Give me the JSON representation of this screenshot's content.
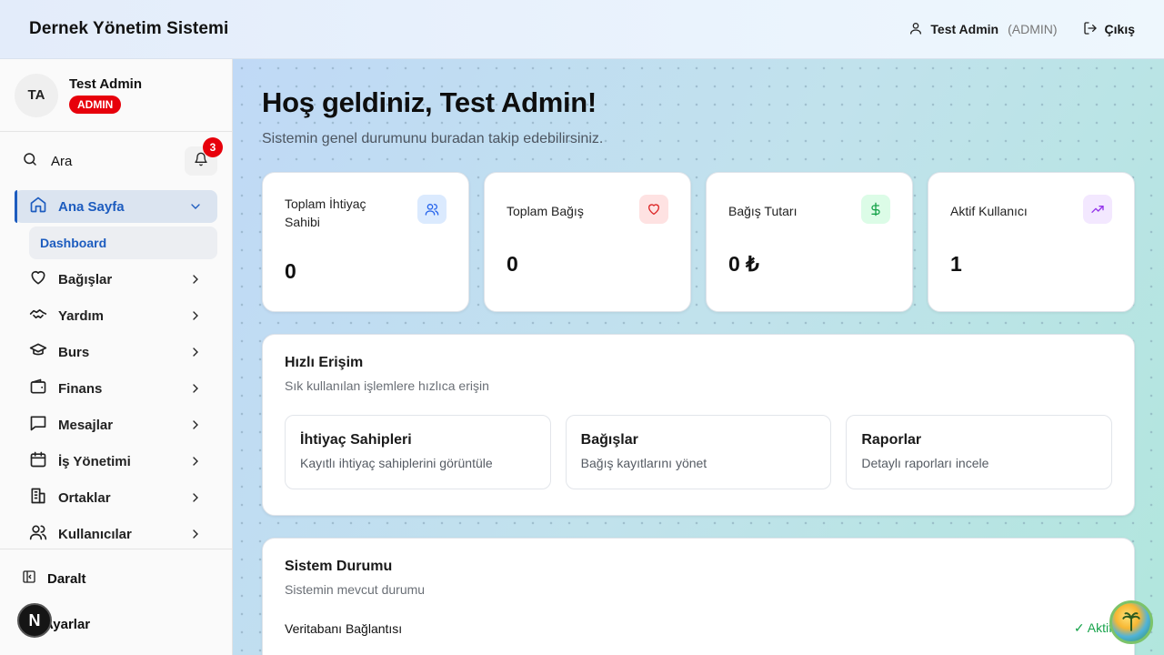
{
  "header": {
    "app_title": "Dernek Yönetim Sistemi",
    "user_name": "Test Admin",
    "user_role": "(ADMIN)",
    "logout_label": "Çıkış"
  },
  "sidebar": {
    "avatar_initials": "TA",
    "profile_name": "Test Admin",
    "profile_badge": "ADMIN",
    "search_label": "Ara",
    "notification_count": "3",
    "items": [
      {
        "label": "Ana Sayfa",
        "icon": "home-icon",
        "active": true
      },
      {
        "label": "Bağışlar",
        "icon": "heart-icon"
      },
      {
        "label": "Yardım",
        "icon": "handshake-icon"
      },
      {
        "label": "Burs",
        "icon": "graduation-cap-icon"
      },
      {
        "label": "Finans",
        "icon": "wallet-icon"
      },
      {
        "label": "Mesajlar",
        "icon": "message-icon"
      },
      {
        "label": "İş Yönetimi",
        "icon": "calendar-icon"
      },
      {
        "label": "Ortaklar",
        "icon": "building-icon"
      },
      {
        "label": "Kullanıcılar",
        "icon": "users-icon"
      }
    ],
    "sub_item": "Dashboard",
    "collapse_label": "Daralt",
    "settings_label": "Ayarlar",
    "dev_badge": "N"
  },
  "main": {
    "welcome_title": "Hoş geldiniz, Test Admin!",
    "welcome_subtitle": "Sistemin genel durumunu buradan takip edebilirsiniz.",
    "stats": [
      {
        "label": "Toplam İhtiyaç Sahibi",
        "value": "0",
        "icon": "users-icon",
        "color": "#2563eb",
        "bg": "#dbeafe"
      },
      {
        "label": "Toplam Bağış",
        "value": "0",
        "icon": "heart-icon",
        "color": "#dc2626",
        "bg": "#fee2e2"
      },
      {
        "label": "Bağış Tutarı",
        "value": "0 ₺",
        "icon": "dollar-icon",
        "color": "#16a34a",
        "bg": "#dcfce7"
      },
      {
        "label": "Aktif Kullanıcı",
        "value": "1",
        "icon": "trending-up-icon",
        "color": "#9333ea",
        "bg": "#f3e8ff"
      }
    ],
    "quick_access": {
      "title": "Hızlı Erişim",
      "subtitle": "Sık kullanılan işlemlere hızlıca erişin",
      "cards": [
        {
          "title": "İhtiyaç Sahipleri",
          "desc": "Kayıtlı ihtiyaç sahiplerini görüntüle"
        },
        {
          "title": "Bağışlar",
          "desc": "Bağış kayıtlarını yönet"
        },
        {
          "title": "Raporlar",
          "desc": "Detaylı raporları incele"
        }
      ]
    },
    "system_status": {
      "title": "Sistem Durumu",
      "subtitle": "Sistemin mevcut durumu",
      "rows": [
        {
          "label": "Veritabanı Bağlantısı",
          "status": "✓ Aktif"
        }
      ]
    }
  }
}
